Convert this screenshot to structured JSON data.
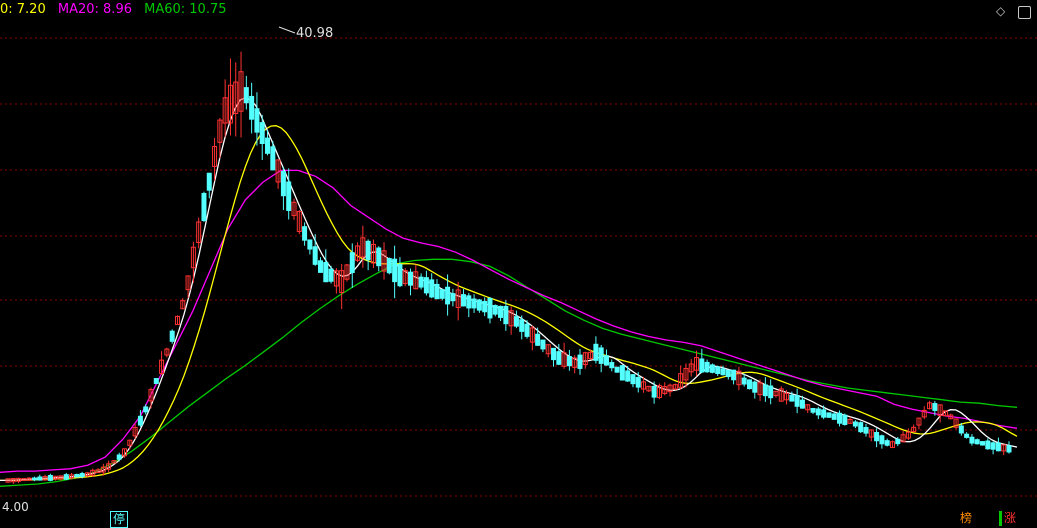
{
  "legend": {
    "ma5": "0: 7.20",
    "ma20": "MA20: 8.96",
    "ma60": "MA60: 10.75"
  },
  "colors": {
    "ma5": "#ffffff",
    "ma10": "#ffff00",
    "ma20": "#ff00ff",
    "ma60": "#00c800",
    "up": "#ff3232",
    "down": "#54ffff",
    "grid": "#8b0000"
  },
  "icons": {
    "settings": "diamond-icon",
    "window": "window-icon"
  },
  "markers": {
    "limit": "停",
    "rank": "榜",
    "rise": "涨"
  },
  "chart_data": {
    "type": "candlestick",
    "high_label": "40.98",
    "low_label": "4.00",
    "ylim": [
      3.0,
      43.0
    ],
    "grid": true,
    "legend_position": "top-left",
    "series": [
      {
        "name": "MA20",
        "values": [
          5.2,
          5.3,
          5.3,
          5.4,
          5.5,
          5.8,
          6.5,
          8.0,
          10.0,
          13.0,
          16.0,
          19.0,
          22.5,
          26.0,
          28.5,
          30.0,
          31.0,
          31.0,
          30.5,
          29.5,
          28.0,
          27.0,
          26.0,
          25.2,
          24.8,
          24.5,
          24.0,
          23.3,
          22.5,
          21.7,
          21.0,
          20.3,
          19.7,
          19.0,
          18.3,
          17.7,
          17.2,
          16.8,
          16.5,
          16.3,
          16.0,
          15.5,
          15.0,
          14.5,
          14.0,
          13.5,
          13.0,
          12.6,
          12.3,
          12.0,
          11.7,
          11.0,
          10.6,
          10.3,
          10.0,
          9.8,
          9.5,
          9.2,
          8.96
        ]
      },
      {
        "name": "MA60",
        "values": [
          4.0,
          4.1,
          4.2,
          4.4,
          4.7,
          5.2,
          6.0,
          7.0,
          8.2,
          9.5,
          10.8,
          12.0,
          13.2,
          14.3,
          15.5,
          16.7,
          18.0,
          19.2,
          20.3,
          21.3,
          22.2,
          23.0,
          23.3,
          23.4,
          23.4,
          23.2,
          22.8,
          22.0,
          21.0,
          20.0,
          19.0,
          18.2,
          17.5,
          17.0,
          16.6,
          16.2,
          15.8,
          15.4,
          15.0,
          14.6,
          14.2,
          13.8,
          13.4,
          13.0,
          12.7,
          12.4,
          12.2,
          12.0,
          11.8,
          11.6,
          11.4,
          11.2,
          11.1,
          10.9,
          10.75
        ]
      }
    ]
  }
}
